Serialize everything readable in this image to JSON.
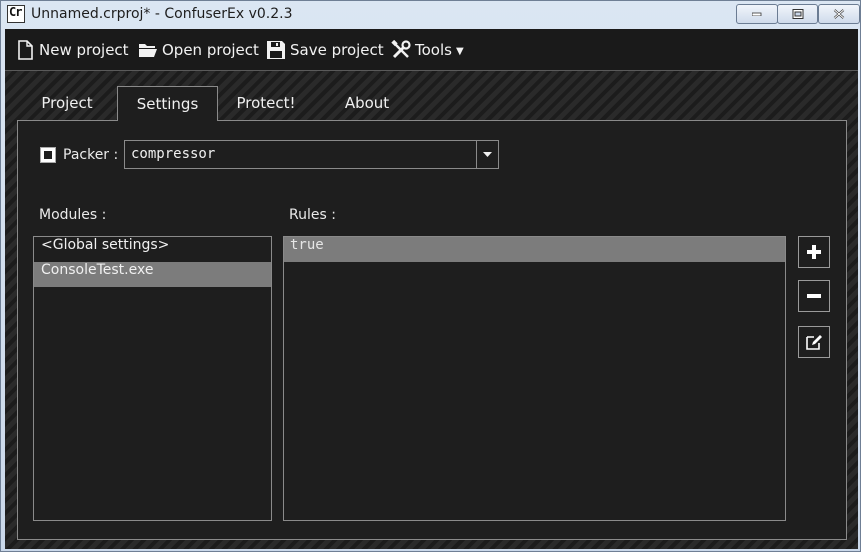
{
  "window": {
    "title": "Unnamed.crproj* - ConfuserEx v0.2.3",
    "icon_text": "Cr"
  },
  "toolbar": {
    "new_project": "New project",
    "open_project": "Open project",
    "save_project": "Save project",
    "tools": "Tools",
    "tools_caret": "▼"
  },
  "tabs": [
    {
      "label": "Project",
      "selected": false
    },
    {
      "label": "Settings",
      "selected": true
    },
    {
      "label": "Protect!",
      "selected": false
    },
    {
      "label": "About",
      "selected": false
    }
  ],
  "settings": {
    "packer_label": "Packer :",
    "packer_checked": true,
    "packer_value": "compressor",
    "modules_label": "Modules :",
    "rules_label": "Rules :",
    "modules": [
      {
        "label": "<Global settings>",
        "selected": false
      },
      {
        "label": "ConsoleTest.exe",
        "selected": true
      }
    ],
    "rules": [
      {
        "label": "true",
        "selected": true
      }
    ],
    "side_buttons": [
      "plus-icon",
      "minus-icon",
      "edit-icon"
    ]
  },
  "colors": {
    "background": "#1e1e1e",
    "selection": "#7c7c7c",
    "border": "#8a8a8a",
    "text": "#f0f0f0"
  }
}
